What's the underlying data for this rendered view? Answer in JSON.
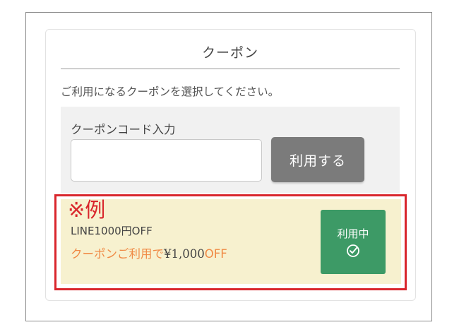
{
  "coupon_section": {
    "title": "クーポン",
    "instruction": "ご利用になるクーポンを選択してください。"
  },
  "code_entry": {
    "label": "クーポンコード入力",
    "input_value": "",
    "apply_button": "利用する"
  },
  "example_mark": "※例",
  "selected_coupon": {
    "name": "LINE1000円OFF",
    "discount_prefix": "クーポンご利用で",
    "discount_amount": "¥1,000",
    "discount_suffix": "OFF",
    "status_button": "利用中",
    "status_icon": "check-circle-icon"
  },
  "colors": {
    "highlight_border": "#d9262c",
    "coupon_background": "#f7f1cf",
    "status_green": "#3d9a66",
    "discount_orange": "#f08a45",
    "apply_gray": "#7b7b7b"
  }
}
